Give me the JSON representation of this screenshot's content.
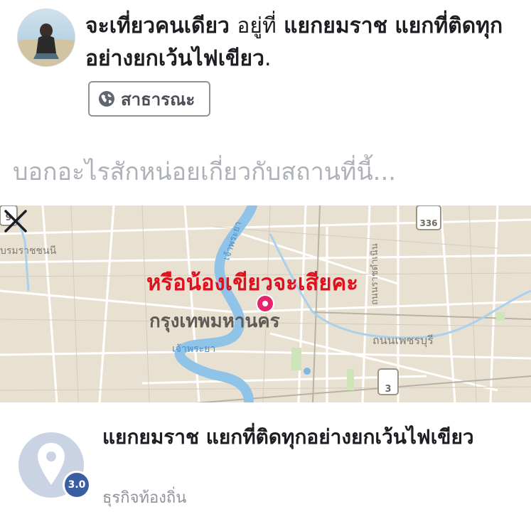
{
  "post": {
    "status_main": "จะเที่ยวคนเดียว",
    "status_at": "อยู่ที่",
    "location_name": "แยกยมราช แยกที่ติดทุกอย่างยกเว้นไฟเขียว",
    "status_end": ".",
    "privacy_label": "สาธารณะ",
    "privacy_icon": "globe-icon"
  },
  "composer": {
    "placeholder": "บอกอะไรสักหน่อยเกี่ยวกับสถานที่นี้..."
  },
  "map": {
    "overlay_text": "หรือน้องเขียวจะเสียคะ",
    "city_label": "กรุงเทพมหานคร",
    "area_label": "บรมราชชนนี",
    "river_labels": [
      "เจ้าพระยา",
      "เจ้าพระยา"
    ],
    "road_label": "ถนนเพชรบุรี",
    "road_vertical_label": "ถนนราชดำเนิน",
    "route_shields": [
      "9",
      "336",
      "3"
    ],
    "pin_color": "#e6236d",
    "overlay_color": "#e0101e",
    "close_icon": "close-icon"
  },
  "place": {
    "name": "แยกยมราช แยกที่ติดทุกอย่างยกเว้นไฟเขียว",
    "rating": "3.0",
    "category": "ธุรกิจท้องถิ่น",
    "icon": "location-pin-icon",
    "rating_color": "#3b5da2"
  }
}
